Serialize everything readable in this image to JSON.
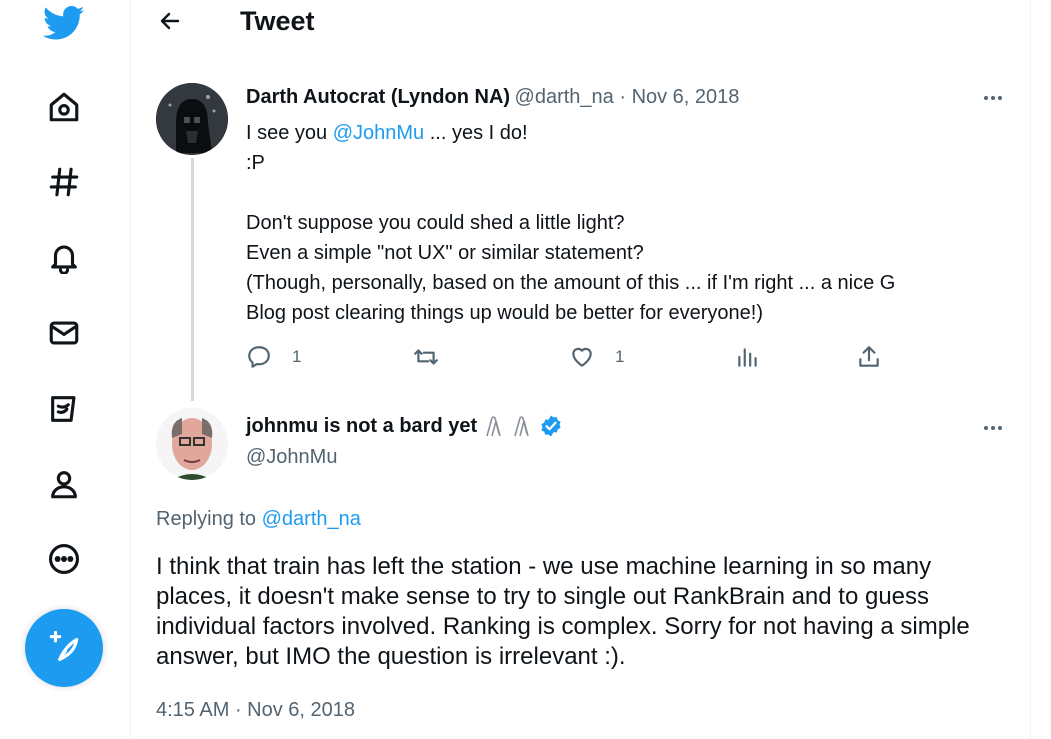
{
  "header": {
    "title": "Tweet"
  },
  "nav": {
    "items": [
      "home-icon",
      "explore-icon",
      "notifications-icon",
      "messages-icon",
      "twitter-blue-icon",
      "profile-icon",
      "more-icon"
    ],
    "compose_icon": "compose-icon",
    "accent": "#1d9bf0"
  },
  "tweet1": {
    "author_name": "Darth Autocrat (Lyndon NA)",
    "handle": "@darth_na",
    "sep": " · ",
    "date": "Nov 6, 2018",
    "line1_pre": "I see you ",
    "line1_mention": "@JohnMu",
    "line1_post": " ... yes I do!",
    "line2": ":P",
    "line3": "Don't suppose you could shed a little light?",
    "line4": "Even a simple \"not UX\" or similar statement?",
    "line5": "(Though, personally, based on the amount of this ... if I'm right ... a nice G",
    "line6": "Blog post clearing things up would be better for everyone!)",
    "reply_count": "1",
    "like_count": "1"
  },
  "tweet2": {
    "author_name": "johnmu is not a bard yet",
    "handle": "@JohnMu",
    "replying_label": "Replying to ",
    "replying_handle": "@darth_na",
    "body": "I think that train has left the station - we use machine learning in so many places, it doesn't make sense to try to single out RankBrain and to guess individual factors involved. Ranking is complex. Sorry for not having a simple answer, but IMO the question is irrelevant :).",
    "time": "4:15 AM",
    "sep": " · ",
    "date": "Nov 6, 2018",
    "verified_color": "#1d9bf0"
  }
}
